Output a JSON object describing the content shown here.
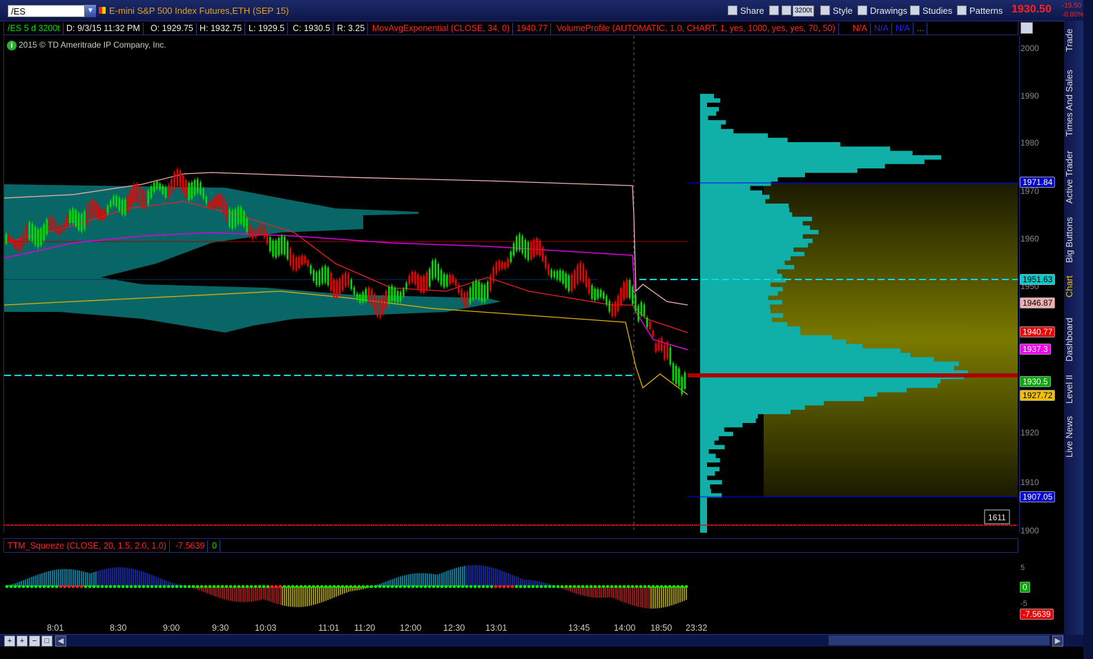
{
  "toolbar": {
    "symbol": "/ES",
    "instrument": "E-mini S&P 500 Index Futures,ETH (SEP 15)",
    "share": "Share",
    "aggregation": "3200t",
    "style": "Style",
    "drawings": "Drawings",
    "studies": "Studies",
    "patterns": "Patterns",
    "last_price": "1930.50",
    "change": "-15.50",
    "change_pct": "-0.80%"
  },
  "infobar": {
    "symbol": "/ES 5 d 3200t",
    "date": "D: 9/3/15 11:32 PM",
    "open": "O: 1929.75",
    "high": "H: 1932.75",
    "low": "L: 1929.5",
    "close": "C: 1930.5",
    "range": "R: 3.25",
    "ema": "MovAvgExponential (CLOSE, 34, 0)",
    "ema_value": "1940.77",
    "vp": "VolumeProfile (AUTOMATIC, 1.0, CHART, 1, yes, 1000, yes, yes, 70, 50)",
    "na1": "N/A",
    "na2": "N/A",
    "na3": "N/A",
    "more": "..."
  },
  "copyright": "2015 © TD Ameritrade IP Company, Inc.",
  "chart_data": {
    "type": "candlestick",
    "y_axis": {
      "ticks": [
        "2000",
        "1990",
        "1980",
        "1970",
        "1960",
        "1950",
        "1940",
        "1930",
        "1920",
        "1910",
        "1900"
      ],
      "min": 1900,
      "max": 2000
    },
    "x_ticks": [
      "8:01",
      "8:30",
      "9:00",
      "9:30",
      "10:03",
      "11:01",
      "11:20",
      "12:00",
      "12:30",
      "13:01",
      "13:45",
      "14:00",
      "18:50",
      "23:32"
    ],
    "price_tags": [
      {
        "label": "1971.84",
        "bg": "#0000cc",
        "fg": "#ffffff"
      },
      {
        "label": "1951.63",
        "bg": "#00cccc",
        "fg": "#000000"
      },
      {
        "label": "1946.87",
        "bg": "#f0b0b0",
        "fg": "#000000"
      },
      {
        "label": "1940.77",
        "bg": "#ee0000",
        "fg": "#ffffff"
      },
      {
        "label": "1937.3",
        "bg": "#ee00ee",
        "fg": "#ffffff"
      },
      {
        "label": "1930.5",
        "bg": "#00aa00",
        "fg": "#ffffff"
      },
      {
        "label": "1927.72",
        "bg": "#f0c000",
        "fg": "#000000"
      },
      {
        "label": "1907.05",
        "bg": "#0000cc",
        "fg": "#ffffff"
      }
    ],
    "volume_label": "1611"
  },
  "lower": {
    "study": "TTM_Squeeze (CLOSE, 20, 1.5, 2.0, 1.0)",
    "value": "-7.5639",
    "signal": "0",
    "ticks": [
      "5",
      "-5"
    ],
    "tag_zero": "0",
    "tag_value": "-7.5639"
  },
  "sidetabs": [
    "Trade",
    "Times And Sales",
    "Active Trader",
    "Big Buttons",
    "Chart",
    "Dashboard",
    "Level II",
    "Live News"
  ]
}
